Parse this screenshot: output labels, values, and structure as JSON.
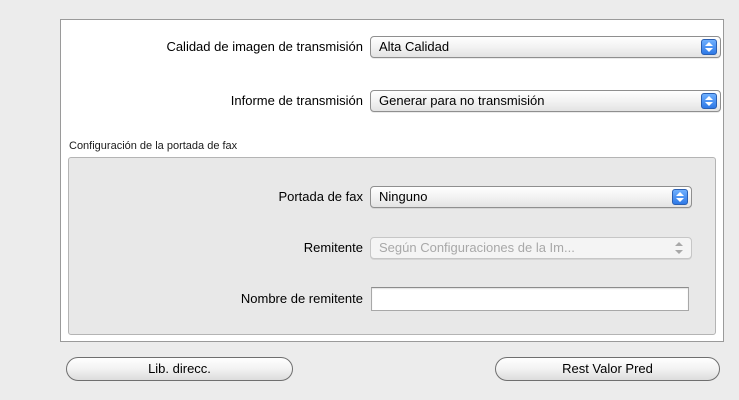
{
  "transmission": {
    "quality_label": "Calidad de imagen de transmisión",
    "quality_value": "Alta Calidad",
    "report_label": "Informe de transmisión",
    "report_value": "Generar para no transmisión"
  },
  "fax_cover": {
    "group_title": "Configuración de la portada de fax",
    "cover_label": "Portada de fax",
    "cover_value": "Ninguno",
    "sender_label": "Remitente",
    "sender_value": "Según Configuraciones de la Im...",
    "sender_name_label": "Nombre de remitente",
    "sender_name_value": ""
  },
  "buttons": {
    "address_book": "Lib. direcc.",
    "restore_defaults": "Rest Valor Pred"
  },
  "icons": {
    "popup_arrows": "up-down-arrows-icon"
  }
}
